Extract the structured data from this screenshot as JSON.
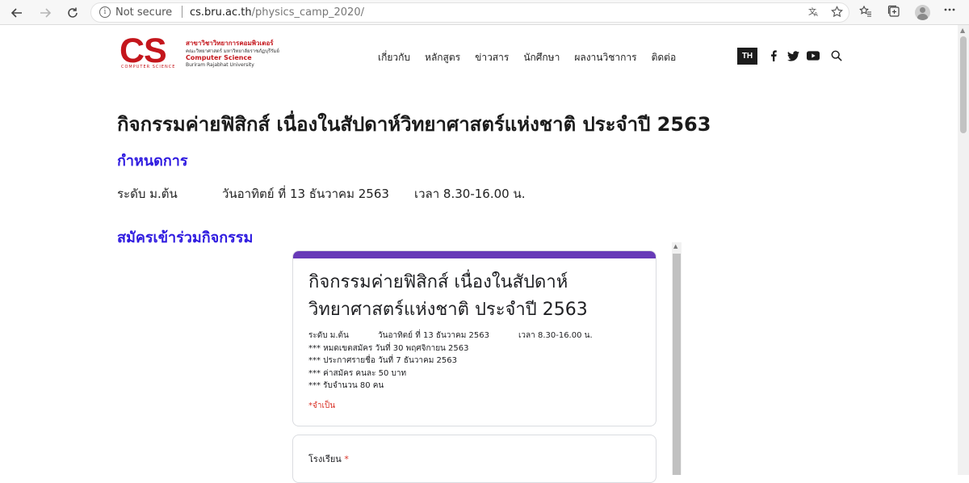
{
  "browser": {
    "security_label": "Not secure",
    "url_host": "cs.bru.ac.th",
    "url_path": "/physics_camp_2020/"
  },
  "site": {
    "logo": {
      "mark": "CS",
      "mark_sub": "COMPUTER   SCIENCE",
      "line1": "สาขาวิชาวิทยาการคอมพิวเตอร์",
      "line2": "คณะวิทยาศาสตร์ มหาวิทยาลัยราชภัฏบุรีรัมย์",
      "line3": "Computer Science",
      "line4": "Buriram Rajabhat University"
    },
    "menu": [
      "เกี่ยวกับ",
      "หลักสูตร",
      "ข่าวสาร",
      "นักศึกษา",
      "ผลงานวิชาการ",
      "ติดต่อ"
    ],
    "lang_button": "TH"
  },
  "content": {
    "title": "กิจกรรมค่ายฟิสิกส์ เนื่องในสัปดาห์วิทยาศาสตร์แห่งชาติ ประจำปี 2563",
    "schedule_heading": "กำหนดการ",
    "schedule": {
      "level": "ระดับ ม.ต้น",
      "date": "วันอาทิตย์ ที่ 13 ธันวาคม 2563",
      "time": "เวลา 8.30-16.00 น."
    },
    "register_heading": "สมัครเข้าร่วมกิจกรรม"
  },
  "form": {
    "title_line1": "กิจกรรมค่ายฟิสิกส์ เนื่องในสัปดาห์",
    "title_line2": "วิทยาศาสตร์แห่งชาติ ประจำปี 2563",
    "desc_level": "ระดับ ม.ต้น",
    "desc_date": "วันอาทิตย์ ที่ 13 ธันวาคม 2563",
    "desc_time": "เวลา 8.30-16.00 น.",
    "notes": [
      "*** หมดเขตสมัคร วันที่ 30 พฤศจิกายน 2563",
      "*** ประกาศรายชื่อ วันที่ 7 ธันวาคม 2563",
      "*** ค่าสมัคร  คนละ 50 บาท",
      "*** รับจำนวน 80 คน"
    ],
    "required_note": "*จำเป็น",
    "question_label": "โรงเรียน",
    "required_star": "*",
    "accent_color": "#673ab7"
  }
}
